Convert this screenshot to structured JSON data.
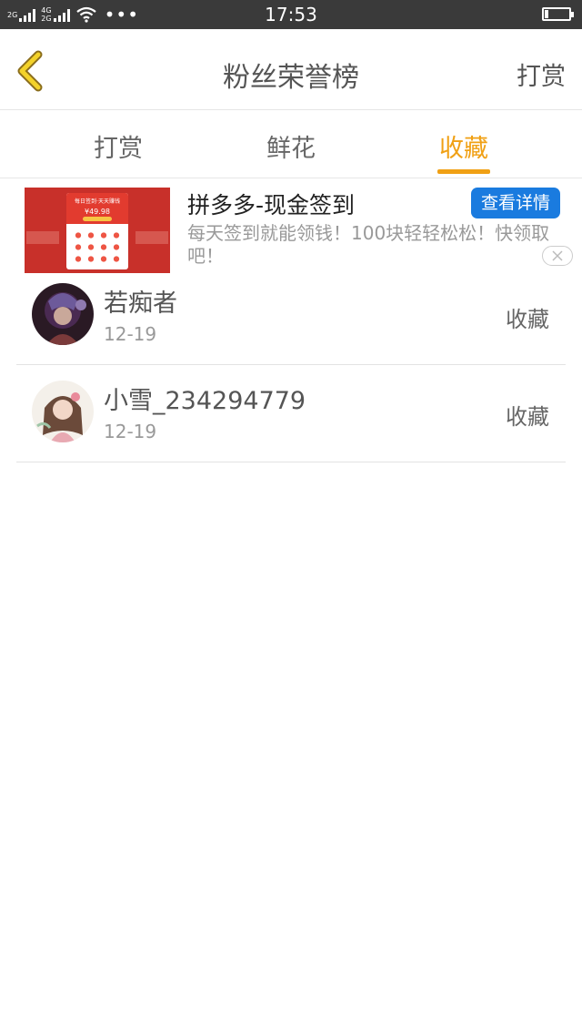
{
  "status_bar": {
    "network1": "2G",
    "network2a": "4G",
    "network2b": "2G",
    "dots": "•••",
    "time": "17:53",
    "battery_level": 0.15
  },
  "header": {
    "title": "粉丝荣誉榜",
    "right_label": "打赏"
  },
  "tabs": [
    {
      "label": "打赏"
    },
    {
      "label": "鲜花"
    },
    {
      "label": "收藏"
    }
  ],
  "active_tab": "收藏",
  "ad": {
    "title": "拼多多-现金签到",
    "description": "每天签到就能领钱！100块轻轻松松！快领取吧！",
    "button": "查看详情",
    "image_title": "每日签到·天天赚钱",
    "image_amount": "¥49.98"
  },
  "list": [
    {
      "name": "若痴者",
      "date": "12-19",
      "action": "收藏"
    },
    {
      "name": "小雪_234294779",
      "date": "12-19",
      "action": "收藏"
    }
  ],
  "colors": {
    "accent": "#f0a014",
    "ad_button": "#1a7bdf",
    "status_bar": "#3a3a3a"
  }
}
